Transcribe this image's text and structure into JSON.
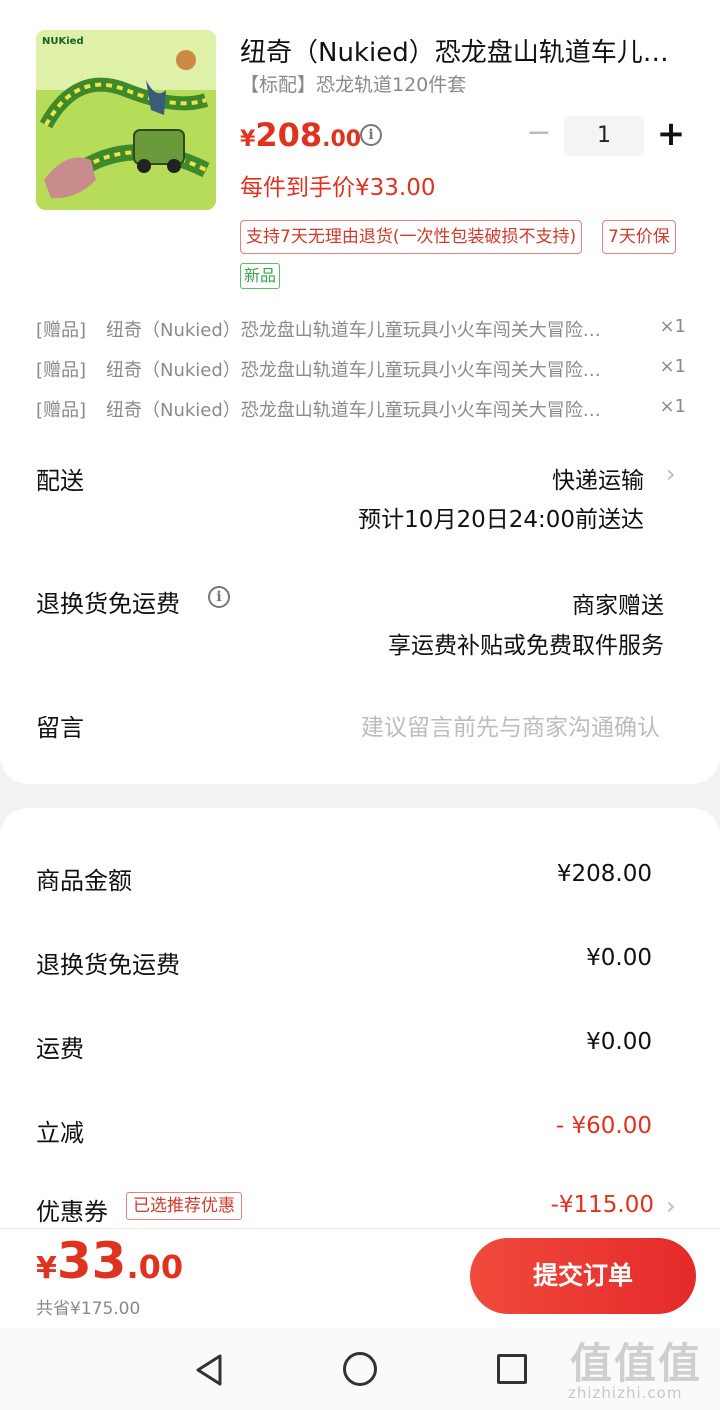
{
  "product": {
    "title": "纽奇（Nukied）恐龙盘山轨道车儿…",
    "spec": "【标配】恐龙轨道120件套",
    "price_currency": "¥",
    "price_int": "208",
    "price_dec": ".00",
    "unit_price": "每件到手价¥33.00",
    "quantity": "1",
    "quantity_minus": "−",
    "quantity_plus": "+",
    "tags": [
      "支持7天无理由退货(一次性包装破损不支持)",
      "7天价保"
    ],
    "new_tag": "新品",
    "brand_logo_text": "NUKied"
  },
  "gifts": [
    {
      "tag": "[赠品]",
      "text": "纽奇（Nukied）恐龙盘山轨道车儿童玩具小火车闯关大冒险…",
      "qty": "×1"
    },
    {
      "tag": "[赠品]",
      "text": "纽奇（Nukied）恐龙盘山轨道车儿童玩具小火车闯关大冒险…",
      "qty": "×1"
    },
    {
      "tag": "[赠品]",
      "text": "纽奇（Nukied）恐龙盘山轨道车儿童玩具小火车闯关大冒险…",
      "qty": "×1"
    }
  ],
  "delivery": {
    "label": "配送",
    "method": "快递运输",
    "eta": "预计10月20日24:00前送达"
  },
  "return_shipping": {
    "label": "退换货免运费",
    "value": "商家赠送",
    "desc": "享运费补贴或免费取件服务"
  },
  "message": {
    "label": "留言",
    "placeholder": "建议留言前先与商家沟通确认"
  },
  "summary": [
    {
      "label": "商品金额",
      "value": "¥208.00"
    },
    {
      "label": "退换货免运费",
      "value": "¥0.00"
    },
    {
      "label": "运费",
      "value": "¥0.00"
    },
    {
      "label": "立减",
      "value": "- ¥60.00"
    },
    {
      "label": "优惠券",
      "value": "-¥115.00",
      "tag": "已选推荐优惠"
    }
  ],
  "footer": {
    "total_currency": "¥",
    "total_int": "33",
    "total_dec": ".00",
    "saved": "共省¥175.00",
    "submit": "提交订单"
  },
  "icons": {
    "info": "info-icon",
    "chevron": "chevron-right-icon",
    "nav_back": "nav-back-icon",
    "nav_home": "nav-home-icon",
    "nav_recent": "nav-recent-icon"
  },
  "watermark": {
    "logo": "值值值",
    "url": "zhizhizhi.com"
  },
  "colors": {
    "accent": "#e0331f",
    "tag_border": "#e7837a",
    "new_tag": "#3aa54c",
    "muted": "#8a8a8a",
    "background": "#f2f2f2"
  }
}
